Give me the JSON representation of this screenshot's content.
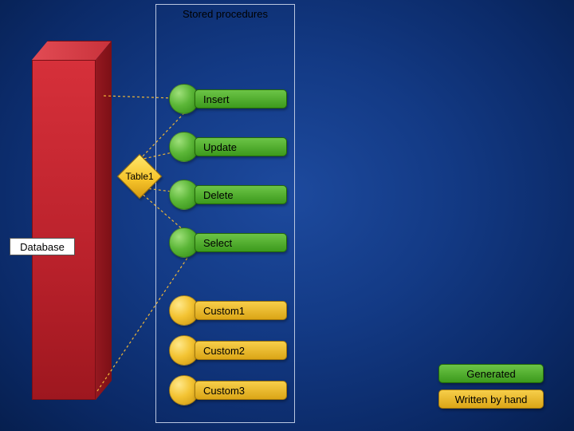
{
  "title": "Stored procedures",
  "database_label": "Database",
  "table_label": "Table1",
  "crud": {
    "insert": "Insert",
    "update": "Update",
    "delete": "Delete",
    "select": "Select"
  },
  "custom": {
    "c1": "Custom1",
    "c2": "Custom2",
    "c3": "Custom3"
  },
  "legend": {
    "generated": "Generated",
    "handwritten": "Written by hand"
  },
  "colors": {
    "generated": "#3c9a1c",
    "handwritten": "#dba516",
    "database": "#b9212b"
  }
}
